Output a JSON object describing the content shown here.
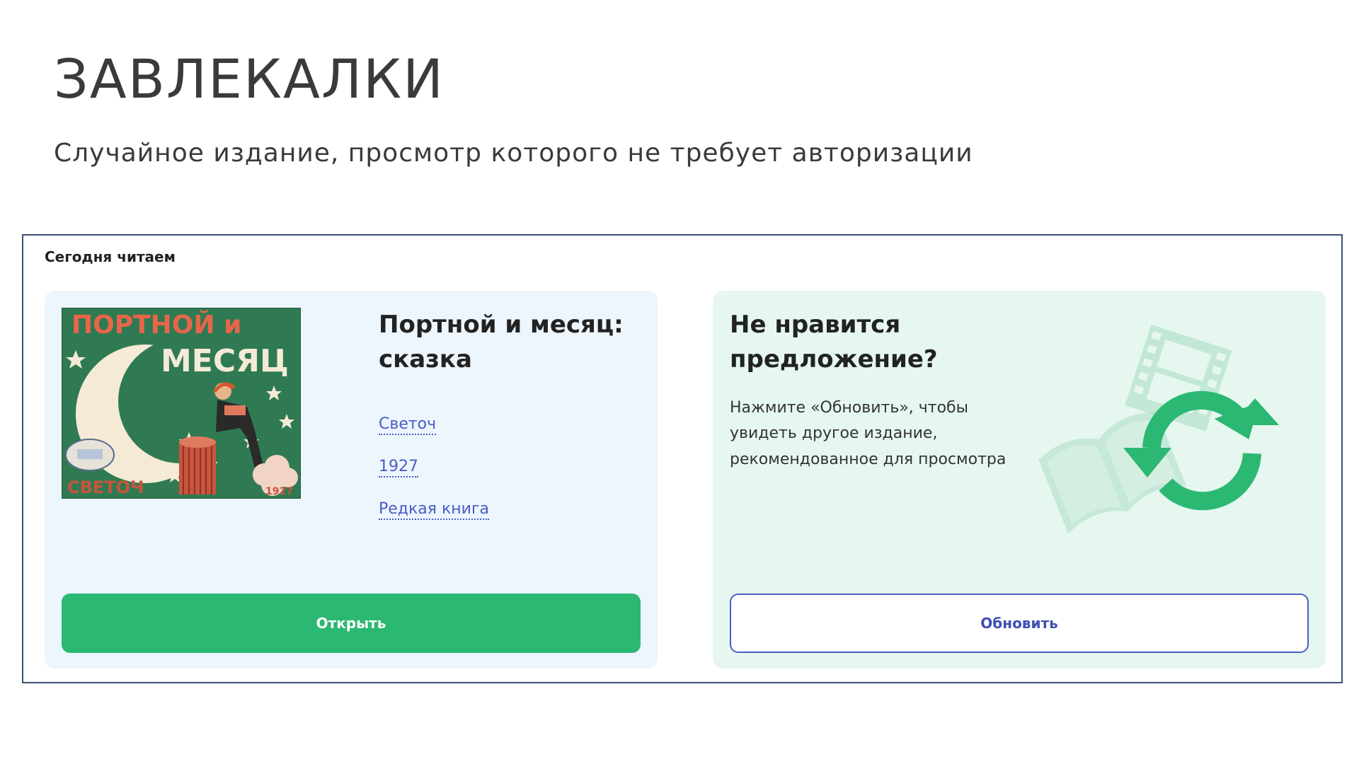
{
  "slide": {
    "title": "ЗАВЛЕКАЛКИ",
    "subtitle": "Случайное издание, просмотр которого не требует авторизации"
  },
  "widget": {
    "heading": "Сегодня читаем",
    "book": {
      "title": "Портной и месяц: сказка",
      "publisher": "Светоч",
      "year": "1927",
      "category": "Редкая книга",
      "open_label": "Открыть",
      "cover_text": {
        "line1": "ПОРТНОЙ и",
        "line2": "МЕСЯЦ",
        "publisher_mark": "СВЕТОЧ",
        "year_mark": "1927"
      }
    },
    "offer": {
      "title": "Не нравится предложение?",
      "text": "Нажмите «Обновить», чтобы увидеть другое издание, рекомендованное для просмотра",
      "refresh_label": "Обновить"
    }
  },
  "colors": {
    "accent_green": "#2bb872",
    "link_blue": "#4a5ec4",
    "book_card_bg": "#edf5fd",
    "offer_card_bg": "#e6f7f0",
    "frame_border": "#3b5374"
  },
  "icons": {
    "cover": "book-cover-image",
    "illustration": "refresh-arrows-icon"
  }
}
